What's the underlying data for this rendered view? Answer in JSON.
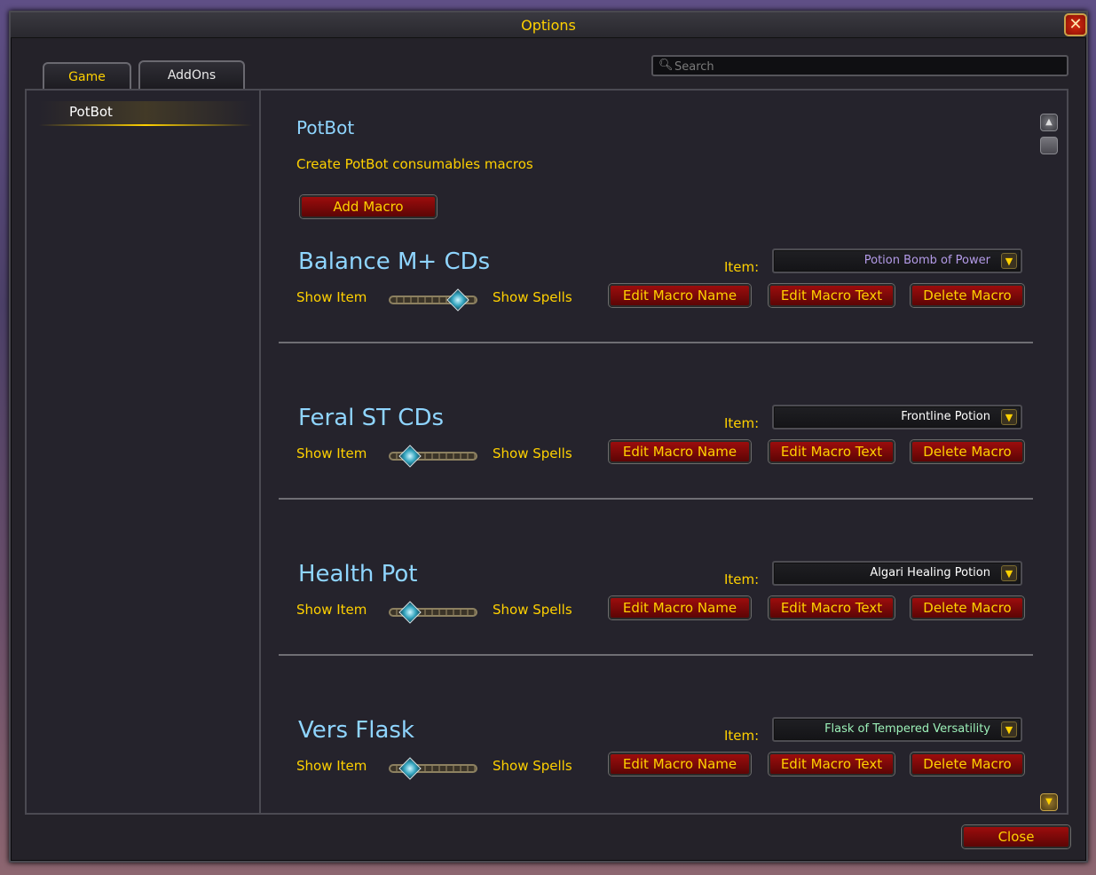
{
  "window": {
    "title": "Options",
    "close_icon": "close-icon"
  },
  "tabs": [
    {
      "label": "Game",
      "active": false
    },
    {
      "label": "AddOns",
      "active": true
    }
  ],
  "search": {
    "placeholder": "Search",
    "value": ""
  },
  "sidebar": {
    "items": [
      {
        "label": "PotBot",
        "selected": true
      }
    ]
  },
  "main": {
    "addon_title": "PotBot",
    "subtitle": "Create PotBot consumables macros",
    "add_macro_label": "Add Macro",
    "item_label": "Item:",
    "show_item_label": "Show Item",
    "show_spells_label": "Show Spells",
    "edit_name_label": "Edit Macro Name",
    "edit_text_label": "Edit Macro Text",
    "delete_label": "Delete Macro",
    "macros": [
      {
        "name": "Balance M+ CDs",
        "item": "Potion Bomb of Power",
        "item_color": "#b49be8",
        "toggle": "Show Spells"
      },
      {
        "name": "Feral ST CDs",
        "item": "Frontline Potion",
        "item_color": "#ffffff",
        "toggle": "Show Item"
      },
      {
        "name": "Health Pot",
        "item": "Algari Healing Potion",
        "item_color": "#ffffff",
        "toggle": "Show Item"
      },
      {
        "name": "Vers Flask",
        "item": "Flask of Tempered Versatility",
        "item_color": "#9cf0b8",
        "toggle": "Show Item"
      }
    ]
  },
  "footer": {
    "close_label": "Close"
  },
  "colors": {
    "gold": "#ffd100",
    "header_blue": "#8fd5ff",
    "button_red": "#8b0a0a"
  }
}
